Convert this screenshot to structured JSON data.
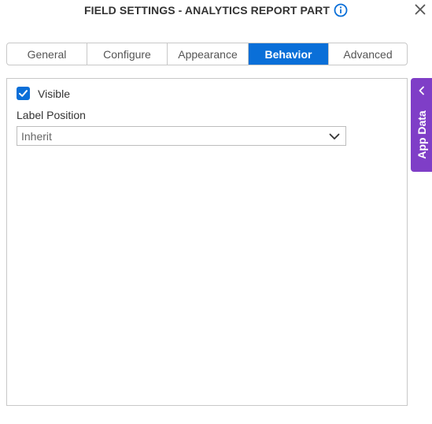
{
  "header": {
    "title": "FIELD SETTINGS - ANALYTICS REPORT PART",
    "info_icon": "info-icon",
    "close_icon": "close-icon"
  },
  "tabs": [
    {
      "label": "General",
      "active": false
    },
    {
      "label": "Configure",
      "active": false
    },
    {
      "label": "Appearance",
      "active": false
    },
    {
      "label": "Behavior",
      "active": true
    },
    {
      "label": "Advanced",
      "active": false
    }
  ],
  "behavior": {
    "visible": {
      "label": "Visible",
      "checked": true
    },
    "label_position": {
      "label": "Label Position",
      "value": "Inherit"
    }
  },
  "side_panel": {
    "label": "App Data",
    "icon": "chevron-left-icon"
  },
  "colors": {
    "accent": "#0a6fd8",
    "side_panel": "#7f3ec7",
    "border": "#c8c8c8"
  }
}
